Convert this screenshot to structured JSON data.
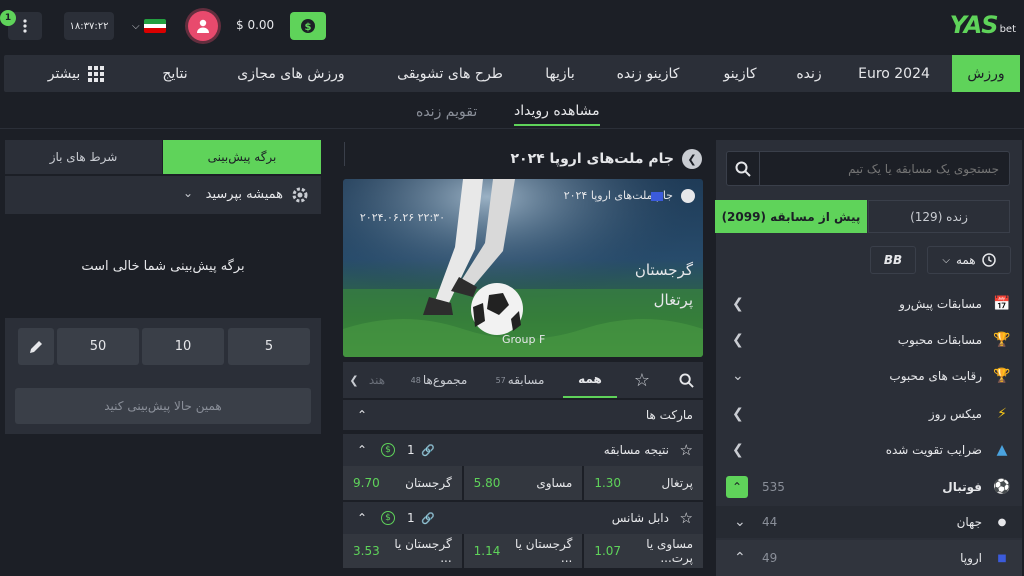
{
  "header": {
    "logo_main": "YAS",
    "logo_sub": "bet",
    "notification_count": "1",
    "clock": "۱۸:۳۷:۲۲",
    "balance": "$ 0.00",
    "colors": {
      "accent": "#5fd35a",
      "avatar": "#e84a6d",
      "panel": "#2b2f38",
      "bg": "#1c1f26"
    }
  },
  "nav": {
    "items": [
      {
        "label": "ورزش",
        "active": true
      },
      {
        "label": "Euro 2024"
      },
      {
        "label": "زنده"
      },
      {
        "label": "کازینو"
      },
      {
        "label": "کازینو زنده"
      },
      {
        "label": "بازیها"
      },
      {
        "label": "طرح های تشویقی"
      },
      {
        "label": "ورزش های مجازی"
      },
      {
        "label": "نتایج"
      },
      {
        "label": "بیشتر"
      }
    ]
  },
  "subtabs": {
    "events": "مشاهده رویداد",
    "calendar": "تقویم زنده"
  },
  "sidebar": {
    "search_placeholder": "جستجوی یک مسابقه یا یک تیم",
    "tab_live": "زنده (129)",
    "tab_prematch": "پیش از مسابقه (2099)",
    "filter_all": "همه",
    "filter_bb": "BB",
    "items": [
      {
        "label": "مسابقات پیش‌رو",
        "icon": "calendar-icon"
      },
      {
        "label": "مسابقات محبوب",
        "icon": "trophy-icon"
      },
      {
        "label": "رقابت های محبوب",
        "icon": "cup-icon"
      },
      {
        "label": "میکس روز",
        "icon": "lightning-icon"
      },
      {
        "label": "ضرایب تقویت شده",
        "icon": "boost-icon"
      }
    ],
    "sports": [
      {
        "label": "فوتبال",
        "count": "535"
      },
      {
        "label": "جهان",
        "count": "44"
      },
      {
        "label": "اروپا",
        "count": "49"
      }
    ]
  },
  "event": {
    "title": "جام ملت‌های اروپا ۲۰۲۴",
    "league": "جام ملت‌های اروپا ۲۰۲۴",
    "datetime": "۲۰۲۴.۰۶.۲۶ ۲۲:۳۰",
    "team1": "گرجستان",
    "team2": "پرتغال",
    "group": "Group F",
    "market_tabs": [
      {
        "label": "همه",
        "active": true
      },
      {
        "label": "مسابقه",
        "count": "57"
      },
      {
        "label": "مجموع‌ها",
        "count": "48"
      },
      {
        "label": "هند"
      }
    ],
    "markets_header": "مارکت ها",
    "market1": {
      "title": "نتیجه مسابقه",
      "link_count": "1",
      "odds": [
        {
          "label": "گرجستان",
          "value": "9.70"
        },
        {
          "label": "مساوی",
          "value": "5.80"
        },
        {
          "label": "پرتغال",
          "value": "1.30"
        }
      ]
    },
    "market2": {
      "title": "دابل شانس",
      "link_count": "1",
      "odds": [
        {
          "label": "گرجستان یا ...",
          "value": "3.53"
        },
        {
          "label": "گرجستان یا ...",
          "value": "1.14"
        },
        {
          "label": "مساوی یا پرت...",
          "value": "1.07"
        }
      ]
    }
  },
  "betslip": {
    "tab_slip": "برگه پیش‌بینی",
    "tab_open": "شرط های باز",
    "accept_mode": "همیشه بپرسید",
    "empty_message": "برگه پیش‌بینی شما خالی است",
    "stakes": [
      "5",
      "10",
      "50"
    ],
    "place_label": "همین حالا پیش‌بینی کنید"
  }
}
